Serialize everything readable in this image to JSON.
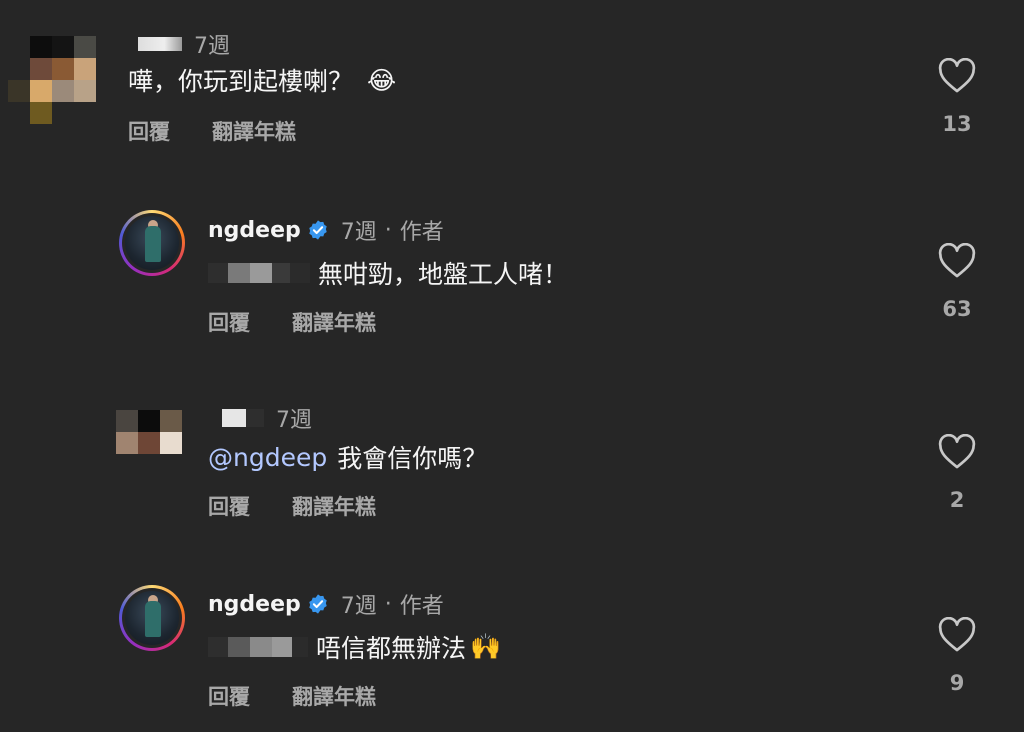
{
  "comments": [
    {
      "time": "7週",
      "text": "嘩，你玩到起樓喇？",
      "emoji": "😂",
      "reply_label": "回覆",
      "translate_label": "翻譯年糕",
      "likes": "13"
    },
    {
      "username": "ngdeep",
      "time": "7週",
      "separator": "·",
      "author_label": "作者",
      "text": "無咁勁，地盤工人啫！",
      "reply_label": "回覆",
      "translate_label": "翻譯年糕",
      "likes": "63"
    },
    {
      "time": "7週",
      "mention": "@ngdeep",
      "text": "我會信你嗎？",
      "reply_label": "回覆",
      "translate_label": "翻譯年糕",
      "likes": "2"
    },
    {
      "username": "ngdeep",
      "time": "7週",
      "separator": "·",
      "author_label": "作者",
      "text": "唔信都無辦法",
      "emoji": "🙌",
      "reply_label": "回覆",
      "translate_label": "翻譯年糕",
      "likes": "9"
    }
  ],
  "icons": {
    "like": "heart-outline-icon",
    "verified": "verified-badge-icon"
  },
  "colors": {
    "background": "#262626",
    "verified": "#3897f0",
    "mention": "#b3c8ff"
  }
}
